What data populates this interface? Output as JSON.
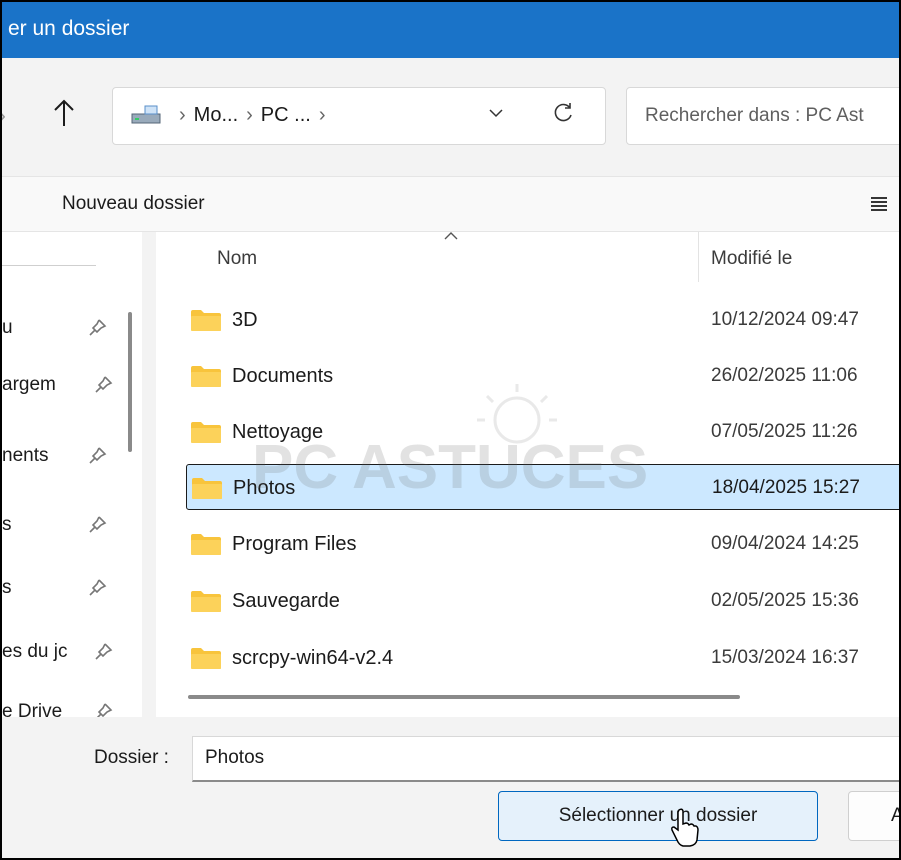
{
  "window": {
    "title": "er un dossier"
  },
  "address": {
    "crumbs": [
      "Mo...",
      "PC ..."
    ],
    "separator": "›",
    "search_placeholder": "Rechercher dans : PC Ast"
  },
  "command_bar": {
    "new_folder": "Nouveau dossier"
  },
  "sidebar": {
    "items": [
      {
        "label": "u"
      },
      {
        "label": "argem"
      },
      {
        "label": "nents"
      },
      {
        "label": "s"
      },
      {
        "label": "s"
      },
      {
        "label": "es du jc"
      },
      {
        "label": "e Drive"
      }
    ]
  },
  "file_list": {
    "columns": {
      "name": "Nom",
      "modified": "Modifié le"
    },
    "rows": [
      {
        "name": "3D",
        "modified": "10/12/2024 09:47",
        "selected": false
      },
      {
        "name": "Documents",
        "modified": "26/02/2025 11:06",
        "selected": false
      },
      {
        "name": "Nettoyage",
        "modified": "07/05/2025 11:26",
        "selected": false
      },
      {
        "name": "Photos",
        "modified": "18/04/2025 15:27",
        "selected": true
      },
      {
        "name": "Program Files",
        "modified": "09/04/2024 14:25",
        "selected": false
      },
      {
        "name": "Sauvegarde",
        "modified": "02/05/2025 15:36",
        "selected": false
      },
      {
        "name": "scrcpy-win64-v2.4",
        "modified": "15/03/2024 16:37",
        "selected": false
      }
    ]
  },
  "watermark": {
    "text_pc": "PC",
    "text_astuces": "ASTUCES"
  },
  "footer": {
    "folder_label": "Dossier :",
    "folder_value": "Photos",
    "select_button": "Sélectionner un dossier",
    "cancel_button": "A"
  },
  "colors": {
    "titlebar": "#1a73c8",
    "selection": "#cce8ff",
    "folder": "#f8c43c",
    "accent_border": "#0067c0"
  },
  "icons": {
    "up": "arrow-up-icon",
    "dropdown": "chevron-down-icon",
    "refresh": "refresh-icon",
    "view": "view-menu-icon",
    "pin": "pin-icon",
    "folder": "folder-icon",
    "cursor": "mouse-cursor-icon"
  }
}
